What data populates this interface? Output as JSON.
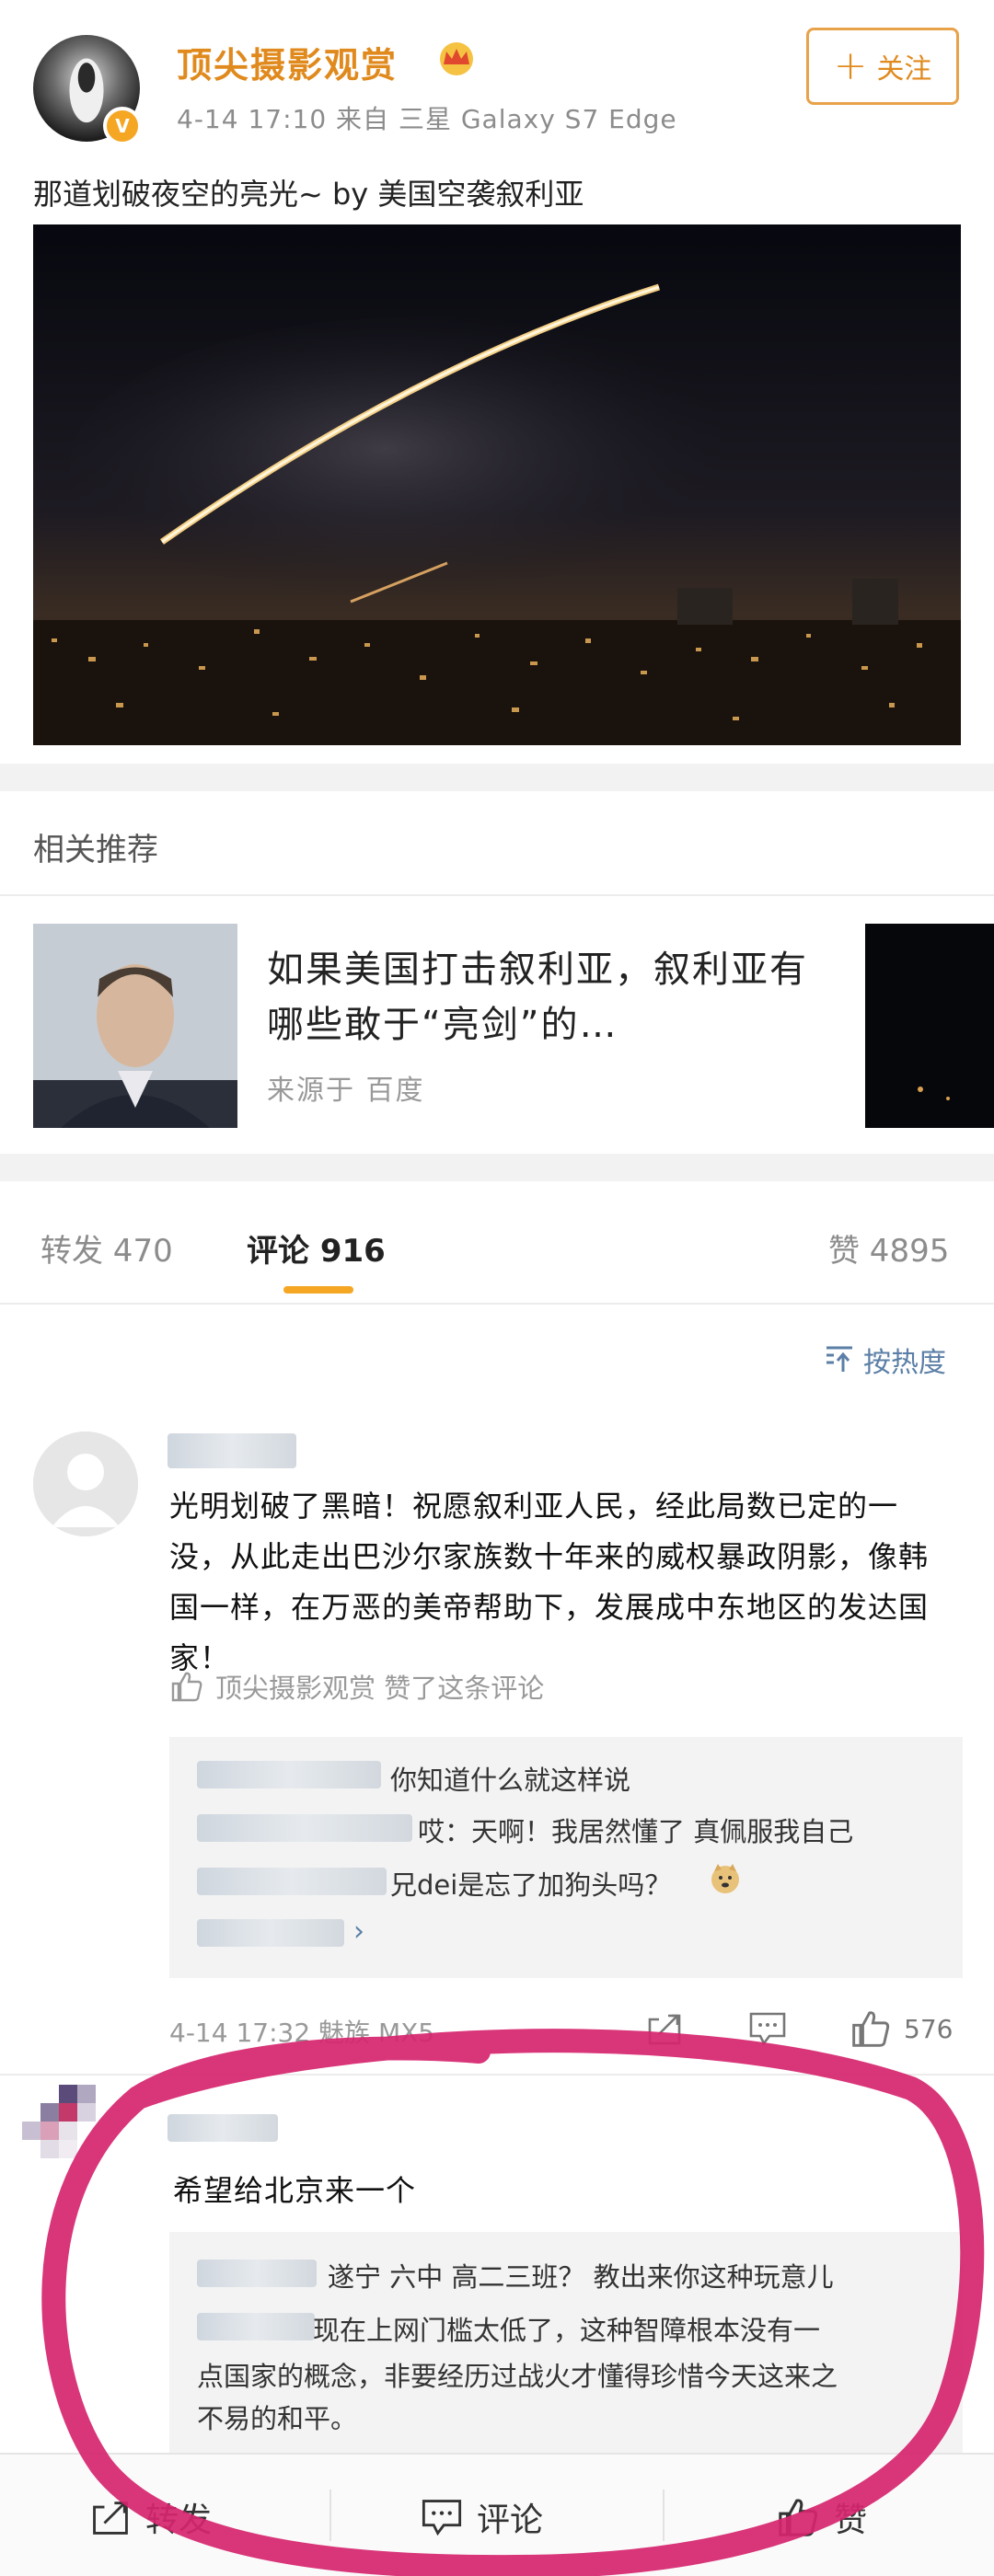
{
  "post": {
    "username": "顶尖摄影观赏",
    "meta": "4-14 17:10  来自 三星 Galaxy S7 Edge",
    "follow_label": "关注",
    "text": "那道划破夜空的亮光~ by 美国空袭叙利亚"
  },
  "related": {
    "section_title": "相关推荐",
    "headline": "如果美国打击叙利亚，叙利亚有哪些敢于“亮剑”的…",
    "source": "来源于 百度"
  },
  "tabs": {
    "repost": "转发 470",
    "comments": "评论 916",
    "likes": "赞 4895"
  },
  "sort_label": "按热度",
  "comment1": {
    "text": "光明划破了黑暗！祝愿叙利亚人民，经此局数已定的一没，从此走出巴沙尔家族数十年来的威权暴政阴影，像韩国一样，在万恶的美帝帮助下，发展成中东地区的发达国家！",
    "liked_by": "顶尖摄影观赏 赞了这条评论",
    "replies": [
      "你知道什么就这样说",
      "哎：天啊！我居然懂了  真佩服我自己",
      "兄dei是忘了加狗头吗？"
    ],
    "meta": "4-14 17:32 魅族 MX5",
    "like_count": "576"
  },
  "comment2": {
    "text": "希望给北京来一个",
    "replies": [
      "遂宁 六中 高二三班？ 教出来你这种玩意儿",
      "现在上网门槛太低了，这种智障根本没有一",
      "点国家的概念，非要经历过战火才懂得珍惜今天这来之",
      "不易的和平。"
    ]
  },
  "bottom_bar": {
    "repost": "转发",
    "comment": "评论",
    "like": "赞"
  },
  "colors": {
    "accent": "#e08a1e",
    "link": "#5b7fa6",
    "annotation": "#d6246e"
  }
}
